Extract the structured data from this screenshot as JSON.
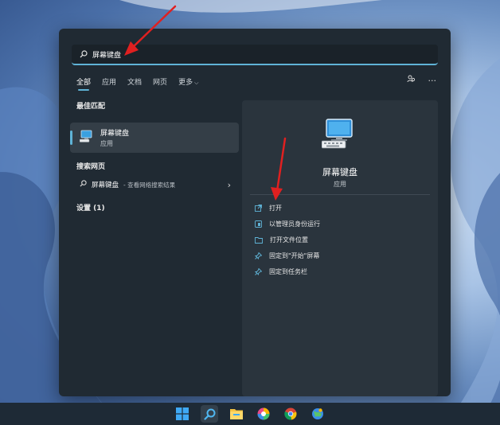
{
  "search": {
    "query": "屏幕键盘"
  },
  "tabs": [
    {
      "label": "全部",
      "active": true
    },
    {
      "label": "应用",
      "active": false
    },
    {
      "label": "文档",
      "active": false
    },
    {
      "label": "网页",
      "active": false
    },
    {
      "label": "更多",
      "active": false
    }
  ],
  "left": {
    "best_match_title": "最佳匹配",
    "best_match": {
      "name": "屏幕键盘",
      "type": "应用",
      "icon": "keyboard-monitor-icon"
    },
    "web_title": "搜索网页",
    "web_result": {
      "query": "屏幕键盘",
      "suffix": " - 查看网络搜索结果"
    },
    "settings_title": "设置 (1)"
  },
  "right": {
    "app_name": "屏幕键盘",
    "app_type": "应用",
    "actions": [
      {
        "label": "打开",
        "icon": "open-external-icon"
      },
      {
        "label": "以管理员身份运行",
        "icon": "admin-shield-icon"
      },
      {
        "label": "打开文件位置",
        "icon": "folder-icon"
      },
      {
        "label": "固定到\"开始\"屏幕",
        "icon": "pin-icon"
      },
      {
        "label": "固定到任务栏",
        "icon": "pin-icon"
      }
    ]
  },
  "taskbar": {
    "items": [
      "start-icon",
      "search-icon",
      "file-explorer-icon",
      "colorful-app-icon",
      "chrome-icon",
      "globe-app-icon"
    ]
  },
  "colors": {
    "accent": "#5fb3d6",
    "panel": "#202a33",
    "annotation": "#e02020"
  }
}
